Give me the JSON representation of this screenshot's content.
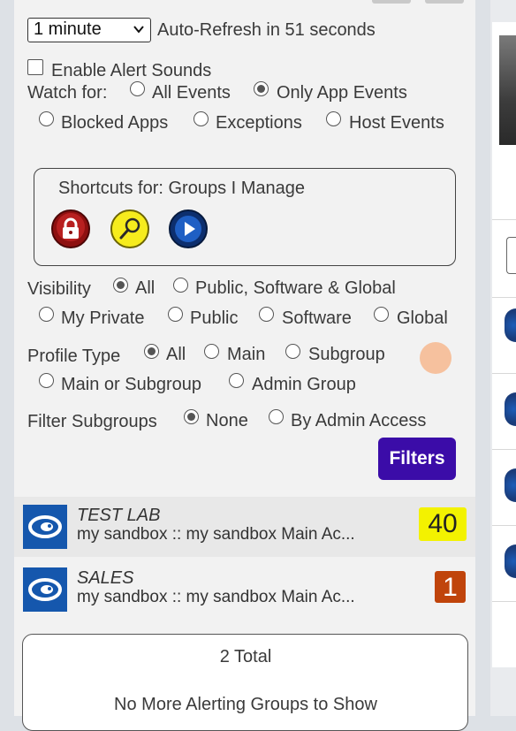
{
  "refresh": {
    "interval_selected": "1 minute",
    "countdown_text": "Auto-Refresh in 51 seconds"
  },
  "alerts": {
    "enable_sounds_label": "Enable Alert Sounds",
    "enable_sounds_checked": false
  },
  "watch_for": {
    "label": "Watch for:",
    "options": [
      "All Events",
      "Only App Events",
      "Blocked Apps",
      "Exceptions",
      "Host Events"
    ],
    "selected": "Only App Events"
  },
  "shortcuts": {
    "title": "Shortcuts for: Groups I Manage",
    "icons": [
      "lock-icon",
      "magnifier-icon",
      "play-icon"
    ]
  },
  "visibility": {
    "label": "Visibility",
    "options": [
      "All",
      "Public, Software & Global",
      "My Private",
      "Public",
      "Software",
      "Global"
    ],
    "selected": "All"
  },
  "profile_type": {
    "label": "Profile Type",
    "options": [
      "All",
      "Main",
      "Subgroup",
      "Main or Subgroup",
      "Admin Group"
    ],
    "selected": "All"
  },
  "filter_subgroups": {
    "label": "Filter Subgroups",
    "options": [
      "None",
      "By Admin Access"
    ],
    "selected": "None"
  },
  "filters_button": "Filters",
  "groups": [
    {
      "name": "TEST LAB",
      "path": "my sandbox :: my sandbox Main Ac...",
      "count": "40",
      "badge_color": "#f3f200"
    },
    {
      "name": "SALES",
      "path": "my sandbox :: my sandbox Main Ac...",
      "count": "1",
      "badge_color": "#c0440b"
    }
  ],
  "summary": {
    "total": "2 Total",
    "footer": "No More Alerting Groups to Show"
  },
  "colors": {
    "filters_button_bg": "#3b0ca8",
    "panel_bg": "#f2f2f2",
    "page_bg": "#dde1e6"
  }
}
